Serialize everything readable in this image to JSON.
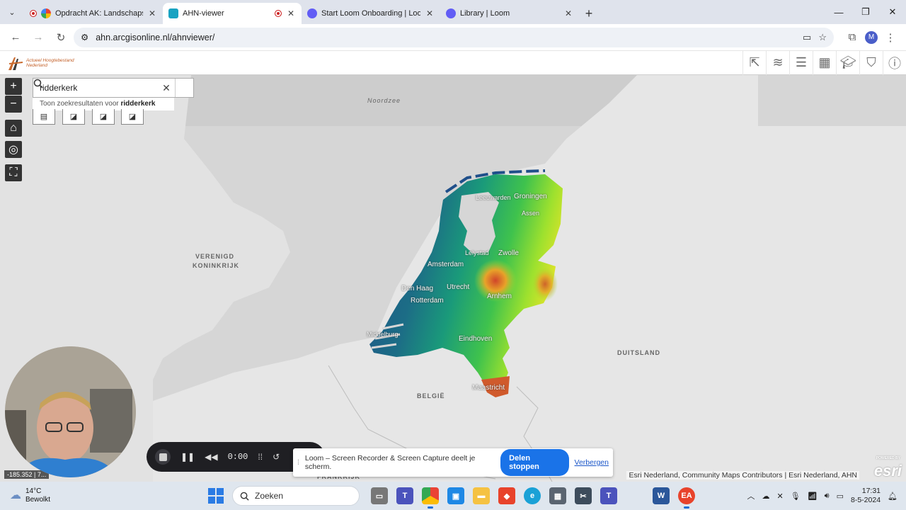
{
  "browser": {
    "tabs": [
      {
        "label": "Opdracht AK: Landschapskenm",
        "favicon_color": "#e0483e",
        "active": false
      },
      {
        "label": "AHN-viewer",
        "favicon_color": "#19a3c2",
        "active": true
      },
      {
        "label": "Start Loom Onboarding | Loom",
        "favicon_color": "#625df5",
        "active": false
      },
      {
        "label": "Library | Loom",
        "favicon_color": "#625df5",
        "active": false
      }
    ],
    "url": "ahn.arcgisonline.nl/ahnviewer/",
    "profile_initial": "M"
  },
  "app": {
    "logo_line1": "Actueel Hoogtebestand",
    "logo_line2": "Nederland",
    "tools": [
      "share-icon",
      "layers-icon",
      "legend-icon",
      "basemap-icon",
      "education-icon",
      "bookmark-icon",
      "info-icon"
    ]
  },
  "search": {
    "value": "ridderkerk",
    "suggestion_prefix": "Toon zoekresultaten voor",
    "suggestion_term": "ridderkerk"
  },
  "map": {
    "sea_labels": [
      "Noordzee"
    ],
    "country_labels": [
      "VERENIGD",
      "KONINKRIJK",
      "DUITSLAND",
      "BELGIË",
      "FRANKRIJK"
    ],
    "cities": [
      "Leeuwarden",
      "Groningen",
      "Assen",
      "Lelystad",
      "Zwolle",
      "Amsterdam",
      "Den Haag",
      "Utrecht",
      "Rotterdam",
      "Arnhem",
      "Middelburg",
      "Eindhoven",
      "Maastricht"
    ],
    "attribution": "Esri Nederland, Community Maps Contributors | Esri Nederland, AHN",
    "esri_powered": "POWERED BY",
    "esri_logo": "esri",
    "coords": "-185.352 | 7..."
  },
  "loom": {
    "time": "0:00",
    "share_message": "Loom – Screen Recorder & Screen Capture deelt je scherm.",
    "stop_label": "Delen stoppen",
    "hide_label": "Verbergen"
  },
  "taskbar": {
    "temp": "14°C",
    "weather": "Bewolkt",
    "search_placeholder": "Zoeken",
    "time": "17:31",
    "date": "8-5-2024"
  }
}
